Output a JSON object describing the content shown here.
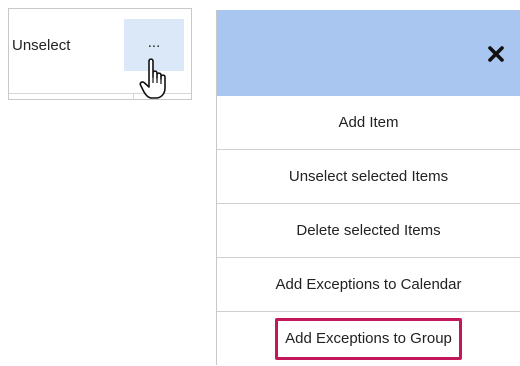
{
  "cell": {
    "label": "Unselect",
    "dots_label": "...",
    "cursor_icon": "hand-pointer-icon"
  },
  "menu": {
    "header_color": "#a8c6f0",
    "close_icon": "close-icon",
    "close_glyph": "✖",
    "highlight_color": "#c2185b",
    "items": [
      {
        "label": "Add Item"
      },
      {
        "label": "Unselect selected Items"
      },
      {
        "label": "Delete selected Items"
      },
      {
        "label": "Add Exceptions to Calendar"
      },
      {
        "label": "Add Exceptions to Group",
        "highlighted": true
      }
    ]
  }
}
